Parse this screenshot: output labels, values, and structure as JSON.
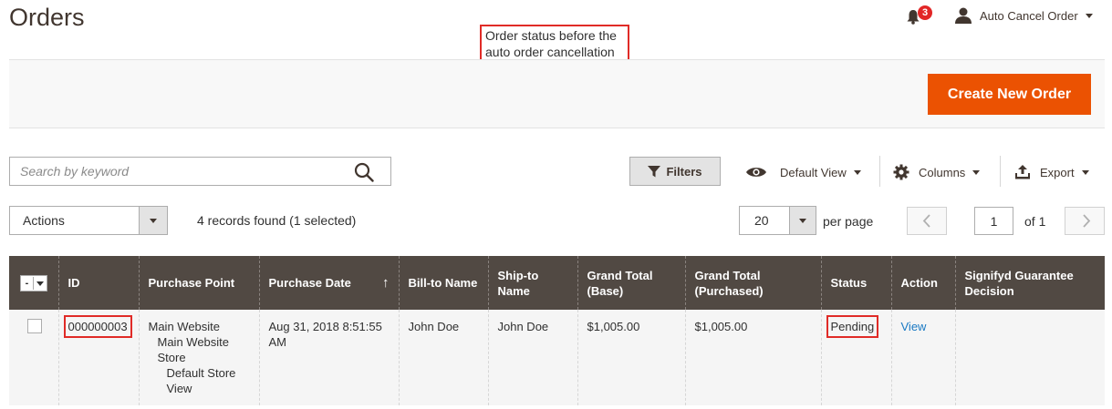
{
  "header": {
    "title": "Orders",
    "notifications_count": "3",
    "user_name": "Auto Cancel Order"
  },
  "annotation": {
    "text_line1": "Order status before the",
    "text_line2": "auto order cancellation"
  },
  "actions": {
    "create_button": "Create New Order"
  },
  "toolbar": {
    "search_placeholder": "Search by keyword",
    "filters_label": "Filters",
    "view_label": "Default View",
    "columns_label": "Columns",
    "export_label": "Export"
  },
  "grid_controls": {
    "mass_action": "Actions",
    "records_found": "4 records found (1 selected)",
    "per_page_value": "20",
    "per_page_label": "per page",
    "current_page": "1",
    "total_pages": "of 1"
  },
  "table": {
    "headers": [
      "ID",
      "Purchase Point",
      "Purchase Date",
      "Bill-to Name",
      "Ship-to Name",
      "Grand Total (Base)",
      "Grand Total (Purchased)",
      "Status",
      "Action",
      "Signifyd Guarantee Decision"
    ],
    "rows": [
      {
        "id": "000000003",
        "purchase_point_1": "Main Website",
        "purchase_point_2": "Main Website Store",
        "purchase_point_3": "Default Store View",
        "purchase_date": "Aug 31, 2018 8:51:55 AM",
        "bill_to": "John Doe",
        "ship_to": "John Doe",
        "grand_total_base": "$1,005.00",
        "grand_total_purchased": "$1,005.00",
        "status": "Pending",
        "action": "View",
        "signifyd": ""
      }
    ]
  },
  "colors": {
    "accent": "#eb5202",
    "header_bg": "#514943",
    "highlight": "#e02b27",
    "link": "#1979c3"
  }
}
